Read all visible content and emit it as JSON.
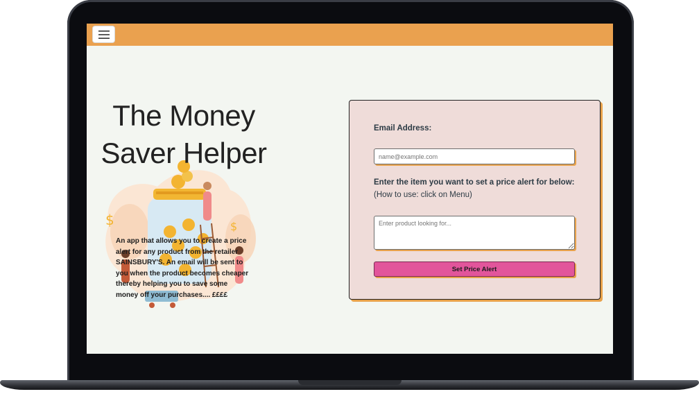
{
  "app": {
    "title": "The Money Saver Helper",
    "title_line1": "The Money",
    "title_line2": "Saver Helper",
    "brand_color": "#eaa14f",
    "accent_color": "#e2559b"
  },
  "navbar": {
    "menu_icon": "hamburger-menu-icon"
  },
  "hero": {
    "description": "An app that allows you to create a price alert for any product from the retailer SAINSBURY'S. An email will be sent to you when the product becomes cheaper thereby helping you to save some money off your purchases.... ££££",
    "illustration_icon": "money-jar-illustration"
  },
  "form": {
    "email_label": "Email Address:",
    "email_placeholder": "name@example.com",
    "item_label": "Enter the item you want to set a price alert for below:",
    "item_hint": "(How to use: click on Menu)",
    "product_placeholder": "Enter product looking for...",
    "submit_label": "Set Price Alert"
  }
}
